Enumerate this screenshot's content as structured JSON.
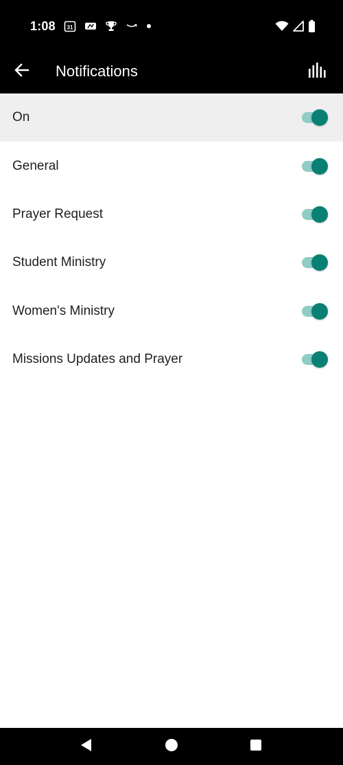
{
  "status_bar": {
    "time": "1:08",
    "calendar_day": "31",
    "left_icons": [
      "calendar-icon",
      "mlb-icon",
      "trophy-icon",
      "amazon-icon",
      "dot-icon"
    ],
    "right_icons": [
      "wifi-icon",
      "signal-icon",
      "battery-icon"
    ]
  },
  "app_bar": {
    "title": "Notifications",
    "back_icon": "arrow-back-icon",
    "action_icon": "bar-chart-icon"
  },
  "settings": {
    "master": {
      "label": "On",
      "enabled": true
    },
    "items": [
      {
        "label": "General",
        "enabled": true
      },
      {
        "label": "Prayer Request",
        "enabled": true
      },
      {
        "label": "Student Ministry",
        "enabled": true
      },
      {
        "label": "Women's Ministry",
        "enabled": true
      },
      {
        "label": "Missions Updates and Prayer",
        "enabled": true
      }
    ]
  },
  "nav_bar": {
    "icons": [
      "nav-back-icon",
      "nav-home-icon",
      "nav-recents-icon"
    ]
  },
  "colors": {
    "toggle_thumb": "#0a8074",
    "toggle_track": "#8fcdc6",
    "bar_background": "#000000",
    "master_row_background": "#efefef"
  }
}
